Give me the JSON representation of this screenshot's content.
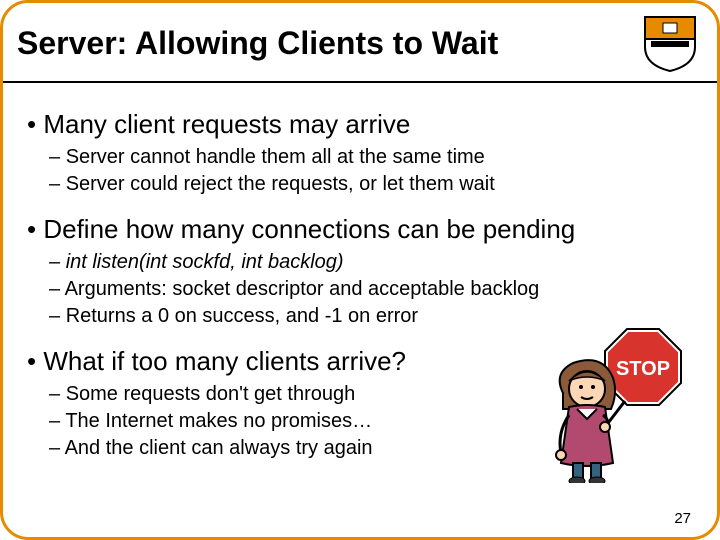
{
  "title": "Server: Allowing Clients to Wait",
  "page_number": "27",
  "bullets": [
    {
      "text": "Many client requests may arrive",
      "subs": [
        "Server cannot handle them all at the same time",
        "Server could reject the requests, or let them wait"
      ]
    },
    {
      "text": "Define how many connections can be pending",
      "subs": [
        "int listen(int sockfd, int backlog)",
        "Arguments: socket descriptor and acceptable backlog",
        "Returns a 0 on success, and -1 on error"
      ]
    },
    {
      "text": "What if too many clients arrive?",
      "subs": [
        "Some requests don't get through",
        "The Internet makes no promises…",
        "And the client can always try again"
      ]
    }
  ],
  "illustration": {
    "sign_text": "STOP",
    "description": "girl-holding-stop-sign"
  },
  "logo": "princeton-shield"
}
